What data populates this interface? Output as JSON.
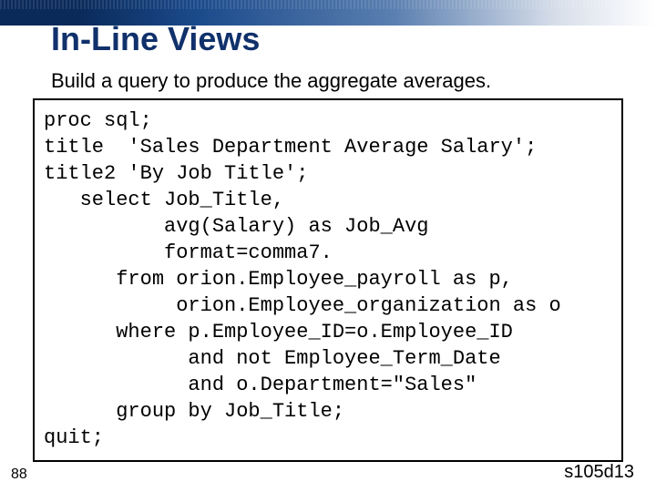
{
  "heading": "In-Line Views",
  "subtitle": "Build a query to produce the aggregate averages.",
  "code": "proc sql;\ntitle  'Sales Department Average Salary';\ntitle2 'By Job Title';\n   select Job_Title,\n          avg(Salary) as Job_Avg\n          format=comma7.\n      from orion.Employee_payroll as p,\n           orion.Employee_organization as o\n      where p.Employee_ID=o.Employee_ID\n            and not Employee_Term_Date\n            and o.Department=\"Sales\"\n      group by Job_Title;\nquit;",
  "page_number": "88",
  "footer_code": "s105d13"
}
